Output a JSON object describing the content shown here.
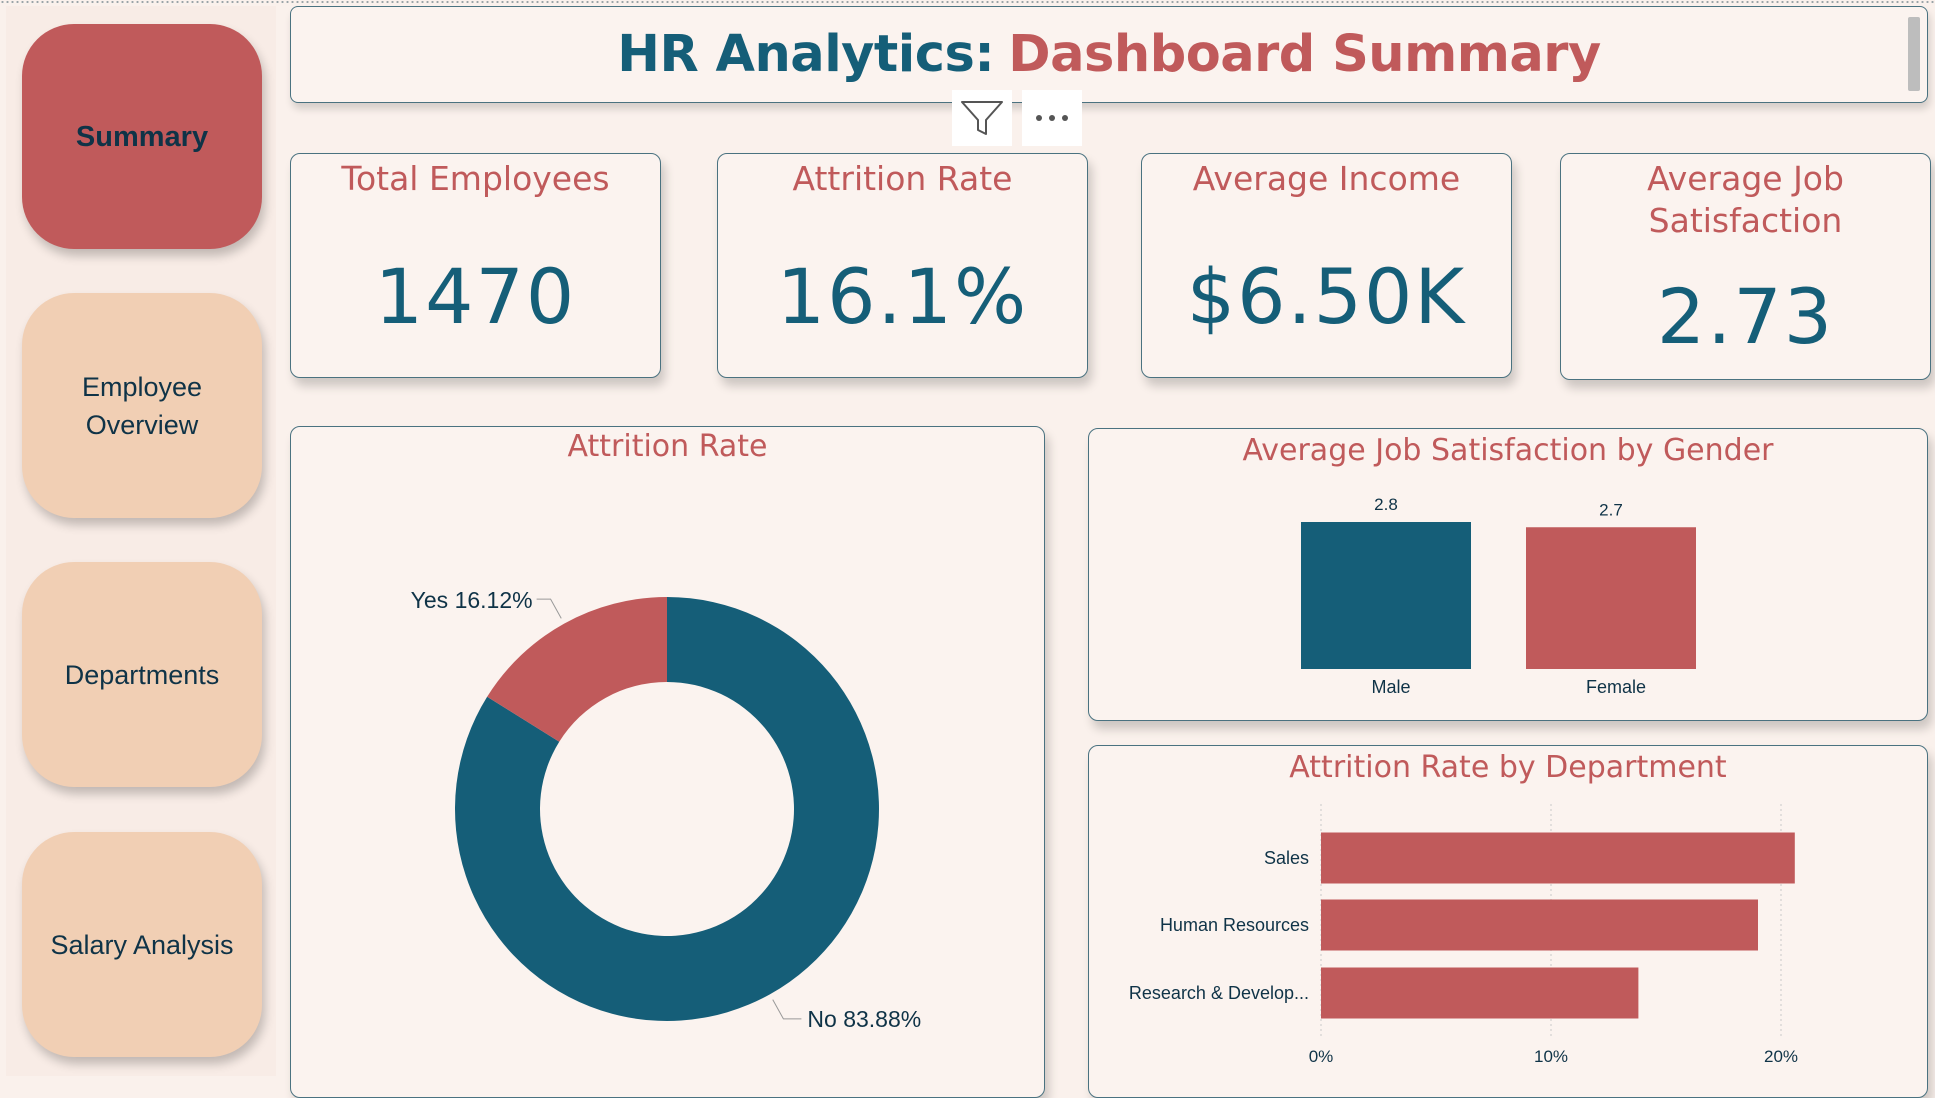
{
  "nav": {
    "items": [
      {
        "label": "Summary"
      },
      {
        "label": "Employee Overview"
      },
      {
        "label": "Departments"
      },
      {
        "label": "Salary Analysis"
      }
    ],
    "active": "Summary"
  },
  "header": {
    "title_part1": "HR Analytics:",
    "title_part2": "Dashboard Summary"
  },
  "visual_header": {
    "filter_icon": "filter-icon",
    "more_icon": "more-options-icon"
  },
  "kpis": [
    {
      "title": "Total Employees",
      "value": "1470"
    },
    {
      "title": "Attrition Rate",
      "value": "16.1%"
    },
    {
      "title": "Average Income",
      "value": "$6.50K"
    },
    {
      "title": "Average Job Satisfaction",
      "value": "2.73"
    }
  ],
  "colors": {
    "teal": "#155e78",
    "red": "#c05a5b",
    "peach": "#f1cfb4",
    "background": "#faf1ec"
  },
  "chart_data": [
    {
      "type": "pie",
      "title": "Attrition Rate",
      "donut": true,
      "slices": [
        {
          "label": "Yes",
          "value": 16.12,
          "display": "Yes 16.12%",
          "color": "#c05a5b"
        },
        {
          "label": "No",
          "value": 83.88,
          "display": "No 83.88%",
          "color": "#155e78"
        }
      ]
    },
    {
      "type": "bar",
      "title": "Average Job Satisfaction by Gender",
      "categories": [
        "Male",
        "Female"
      ],
      "values": [
        2.8,
        2.7
      ],
      "value_labels": [
        "2.8",
        "2.7"
      ],
      "colors": [
        "#155e78",
        "#c05a5b"
      ]
    },
    {
      "type": "bar",
      "orientation": "horizontal",
      "title": "Attrition Rate by Department",
      "categories": [
        "Sales",
        "Human Resources",
        "Research & Develop..."
      ],
      "values": [
        20.6,
        19.0,
        13.8
      ],
      "xlim": [
        0,
        25
      ],
      "xticks": [
        0,
        10,
        20
      ],
      "xtick_labels": [
        "0%",
        "10%",
        "20%"
      ],
      "grid": true,
      "color": "#c05a5b"
    }
  ]
}
